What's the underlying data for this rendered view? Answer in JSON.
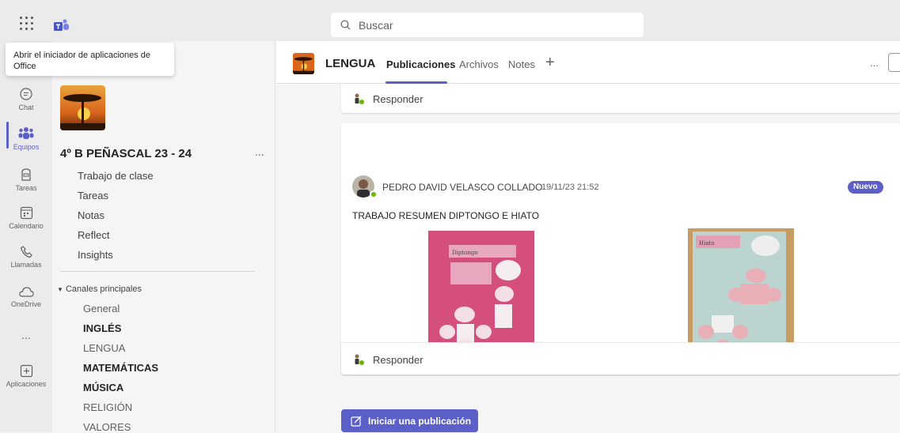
{
  "search": {
    "placeholder": "Buscar"
  },
  "tooltip": {
    "text": "Abrir el iniciador de aplicaciones de Office"
  },
  "rail": {
    "items": [
      {
        "label": "Chat",
        "icon": "chat-icon"
      },
      {
        "label": "Equipos",
        "icon": "teams-icon",
        "active": true
      },
      {
        "label": "Tareas",
        "icon": "assignments-icon"
      },
      {
        "label": "Calendario",
        "icon": "calendar-icon"
      },
      {
        "label": "Llamadas",
        "icon": "calls-icon"
      },
      {
        "label": "OneDrive",
        "icon": "cloud-icon"
      },
      {
        "label": "...",
        "icon": "more-icon"
      },
      {
        "label": "Aplicaciones",
        "icon": "add-apps-icon"
      }
    ]
  },
  "team": {
    "name": "4º B PEÑASCAL 23 - 24",
    "more": "...",
    "nav": [
      "Trabajo de clase",
      "Tareas",
      "Notas",
      "Reflect",
      "Insights"
    ],
    "section": "Canales principales",
    "channels": [
      {
        "label": "General",
        "bold": false
      },
      {
        "label": "INGLÉS",
        "bold": true
      },
      {
        "label": "LENGUA",
        "bold": false
      },
      {
        "label": "MATEMÁTICAS",
        "bold": true
      },
      {
        "label": "MÚSICA",
        "bold": true
      },
      {
        "label": "RELIGIÓN",
        "bold": false
      },
      {
        "label": "VALORES",
        "bold": false
      }
    ]
  },
  "channel": {
    "title": "LENGUA",
    "tabs": [
      "Publicaciones",
      "Archivos",
      "Notes"
    ],
    "more": "..."
  },
  "posts": {
    "reply_label": "Responder",
    "author": "PEDRO DAVID VELASCO COLLADO",
    "timestamp": "19/11/23 21:52",
    "badge": "Nuevo",
    "text": "TRABAJO RESUMEN  DIPTONGO E HIATO",
    "image1_title": "Diptongo",
    "image2_title": "Hiato"
  },
  "new_post": {
    "label": "Iniciar una publicación"
  },
  "colors": {
    "accent": "#5b5fc7",
    "presence": "#6bb700",
    "sidebar": "#ebebeb"
  }
}
